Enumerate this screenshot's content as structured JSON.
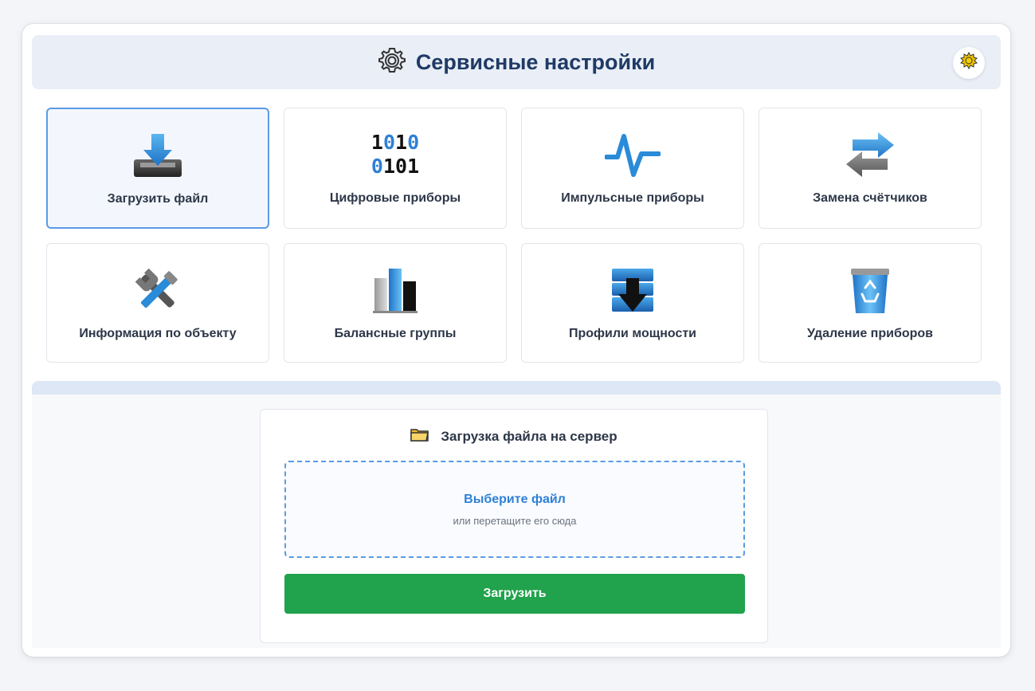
{
  "header": {
    "title": "Сервисные настройки",
    "icon": "gear-icon"
  },
  "theme_toggle": {
    "icon": "sun-icon"
  },
  "tiles": [
    {
      "label": "Загрузить файл",
      "icon": "download-tray-icon",
      "active": true
    },
    {
      "label": "Цифровые приборы",
      "icon": "binary-icon",
      "binary_top": "1010",
      "binary_bottom": "0101"
    },
    {
      "label": "Импульсные приборы",
      "icon": "pulse-icon"
    },
    {
      "label": "Замена счётчиков",
      "icon": "swap-arrows-icon"
    },
    {
      "label": "Информация по объекту",
      "icon": "tools-icon"
    },
    {
      "label": "Балансные группы",
      "icon": "bar-chart-icon"
    },
    {
      "label": "Профили мощности",
      "icon": "database-download-icon"
    },
    {
      "label": "Удаление приборов",
      "icon": "recycle-bin-icon"
    }
  ],
  "upload": {
    "title": "Загрузка файла на сервер",
    "title_icon": "folder-icon",
    "choose_label": "Выберите файл",
    "hint": "или перетащите его сюда",
    "button_label": "Загрузить"
  },
  "colors": {
    "accent": "#2f80d6",
    "title": "#1f3a66",
    "button": "#21a24c"
  }
}
